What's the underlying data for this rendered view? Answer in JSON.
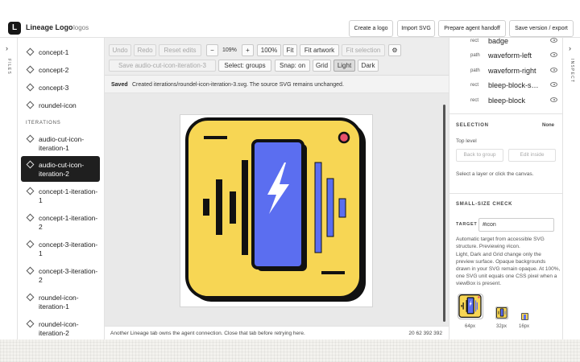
{
  "header": {
    "logo_letter": "L",
    "app_title": "Lineage Logo",
    "project": "logos",
    "buttons": [
      "Create a logo",
      "Import SVG",
      "Prepare agent handoff",
      "Save version / export"
    ]
  },
  "left_rail": {
    "label": "FILES"
  },
  "right_rail": {
    "label": "INSPECT"
  },
  "sidebar": {
    "files": [
      {
        "label": "concept-1"
      },
      {
        "label": "concept-2"
      },
      {
        "label": "concept-3"
      },
      {
        "label": "roundel-icon"
      }
    ],
    "section_label": "ITERATIONS",
    "iterations": [
      {
        "label": "audio-cut-icon-iteration-1"
      },
      {
        "label": "audio-cut-icon-iteration-2",
        "active": true
      },
      {
        "label": "concept-1-iteration-1"
      },
      {
        "label": "concept-1-iteration-2"
      },
      {
        "label": "concept-3-iteration-1"
      },
      {
        "label": "concept-3-iteration-2"
      },
      {
        "label": "roundel-icon-iteration-1"
      },
      {
        "label": "roundel-icon-iteration-2"
      }
    ]
  },
  "toolbar": {
    "undo": "Undo",
    "redo": "Redo",
    "reset": "Reset edits",
    "zoom_out": "−",
    "zoom_level": "109%",
    "zoom_in": "+",
    "zoom_100": "100%",
    "fit": "Fit",
    "fit_artwork": "Fit artwork",
    "fit_selection": "Fit selection",
    "save_as": "Save audio-cut-icon-iteration-3",
    "select_mode": "Select: groups",
    "snap": "Snap: on",
    "grid": "Grid",
    "light": "Light",
    "dark": "Dark"
  },
  "status": {
    "saved": "Saved",
    "message": "Created iterations/roundel-icon-iteration-3.svg. The source SVG remains unchanged."
  },
  "footer": {
    "message": "Another Lineage tab owns the agent connection. Close that tab before retrying here.",
    "coords": "20 62 392 392"
  },
  "inspector": {
    "layers": [
      {
        "type": "rect",
        "name": "badge"
      },
      {
        "type": "path",
        "name": "waveform-left"
      },
      {
        "type": "path",
        "name": "waveform-right"
      },
      {
        "type": "rect",
        "name": "bleep-block-s…"
      },
      {
        "type": "rect",
        "name": "bleep-block"
      }
    ],
    "selection_title": "SELECTION",
    "selection_value": "None",
    "top_level": "Top level",
    "back_to_group": "Back to group",
    "edit_inside": "Edit inside",
    "selection_hint": "Select a layer or click the canvas.",
    "small_check_title": "SMALL-SIZE CHECK",
    "target_label": "TARGET",
    "target_value": "#icon",
    "auto_note": "Automatic target from accessible SVG structure. Previewing #icon.",
    "preview_note": "Light, Dark and Grid change only the preview surface. Opaque backgrounds drawn in your SVG remain opaque. At 100%, one SVG unit equals one CSS pixel when a viewBox is present.",
    "previews": [
      "64px",
      "32px",
      "16px"
    ]
  },
  "colors": {
    "badge_yellow": "#f7d654",
    "panel_blue": "#5b6ef0",
    "dot_red": "#e8506a",
    "outline": "#111111"
  }
}
